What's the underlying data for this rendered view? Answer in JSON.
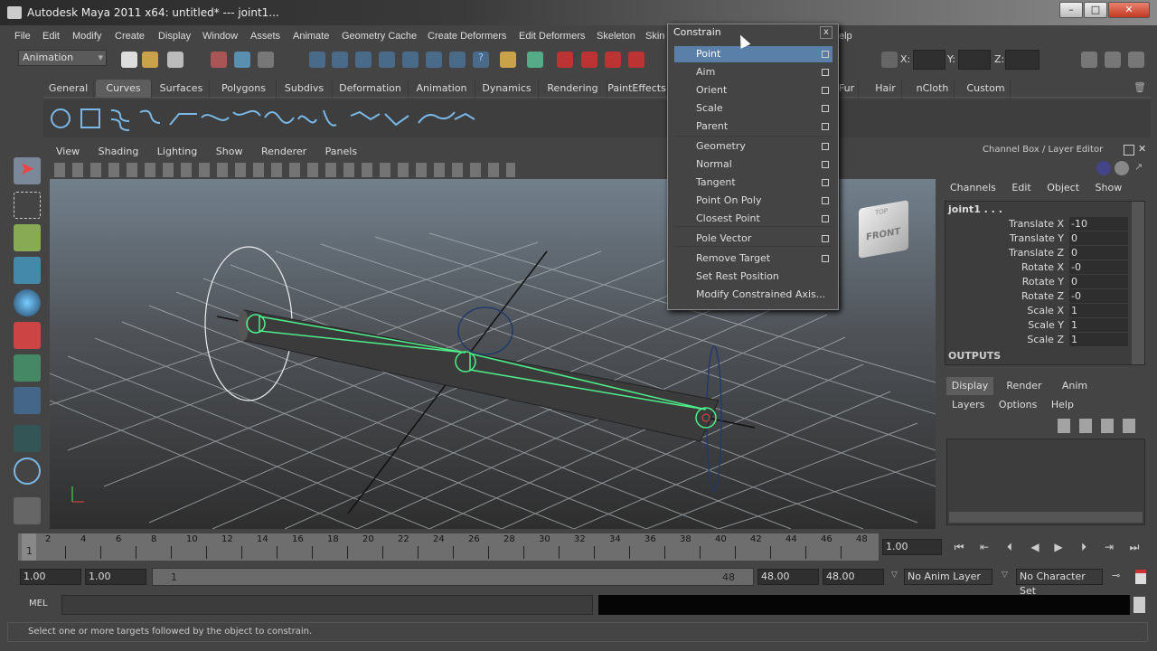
{
  "window": {
    "title": "Autodesk Maya 2011 x64: untitled*   ---   joint1...",
    "min": "–",
    "max": "□",
    "close": "✕"
  },
  "menubar": [
    "File",
    "Edit",
    "Modify",
    "Create",
    "Display",
    "Window",
    "Assets",
    "Animate",
    "Geometry Cache",
    "Create Deformers",
    "Edit Deformers",
    "Skeleton",
    "Skin"
  ],
  "menubar_tail": "elp",
  "toolbar": {
    "menu_set": "Animation",
    "x_label": "X:",
    "y_label": "Y:",
    "z_label": "Z:"
  },
  "shelf_tabs": [
    "General",
    "Curves",
    "Surfaces",
    "Polygons",
    "Subdivs",
    "Deformation",
    "Animation",
    "Dynamics",
    "Rendering",
    "PaintEffects"
  ],
  "shelf_tabs_right": [
    "Fur",
    "Hair",
    "nCloth",
    "Custom"
  ],
  "viewport": {
    "menu": [
      "View",
      "Shading",
      "Lighting",
      "Show",
      "Renderer",
      "Panels"
    ],
    "viewcube_top": "TOP",
    "viewcube_front": "FRONT"
  },
  "channel_box": {
    "title": "Channel Box / Layer Editor",
    "menu": [
      "Channels",
      "Edit",
      "Object",
      "Show"
    ],
    "object": "joint1 . . .",
    "channels": [
      {
        "label": "Translate X",
        "value": "-10"
      },
      {
        "label": "Translate Y",
        "value": "0"
      },
      {
        "label": "Translate Z",
        "value": "0"
      },
      {
        "label": "Rotate X",
        "value": "-0"
      },
      {
        "label": "Rotate Y",
        "value": "0"
      },
      {
        "label": "Rotate Z",
        "value": "-0"
      },
      {
        "label": "Scale X",
        "value": "1"
      },
      {
        "label": "Scale Y",
        "value": "1"
      },
      {
        "label": "Scale Z",
        "value": "1"
      }
    ],
    "outputs": "OUTPUTS"
  },
  "layer_editor": {
    "tabs": [
      "Display",
      "Render",
      "Anim"
    ],
    "menu": [
      "Layers",
      "Options",
      "Help"
    ]
  },
  "constrain_menu": {
    "title": "Constrain",
    "close": "x",
    "items": [
      {
        "label": "Point",
        "option": true,
        "highlighted": true
      },
      {
        "label": "Aim",
        "option": true
      },
      {
        "label": "Orient",
        "option": true
      },
      {
        "label": "Scale",
        "option": true
      },
      {
        "label": "Parent",
        "option": true
      },
      {
        "label": "Geometry",
        "option": true
      },
      {
        "label": "Normal",
        "option": true
      },
      {
        "label": "Tangent",
        "option": true
      },
      {
        "label": "Point On Poly",
        "option": true
      },
      {
        "label": "Closest Point",
        "option": true
      },
      {
        "label": "Pole Vector",
        "option": true
      },
      {
        "label": "Remove Target",
        "option": true
      },
      {
        "label": "Set Rest Position",
        "option": false
      },
      {
        "label": "Modify Constrained Axis...",
        "option": false
      }
    ]
  },
  "timeline": {
    "ticks": [
      "2",
      "4",
      "6",
      "8",
      "10",
      "12",
      "14",
      "16",
      "18",
      "20",
      "22",
      "24",
      "26",
      "28",
      "30",
      "32",
      "34",
      "36",
      "38",
      "40",
      "42",
      "44",
      "46",
      "48"
    ],
    "current": "1",
    "current_time": "1.00"
  },
  "range": {
    "start": "1.00",
    "playback_start": "1.00",
    "slider_start": "1",
    "slider_end": "48",
    "playback_end": "48.00",
    "end": "48.00",
    "anim_layer": "No Anim Layer",
    "character_set": "No Character Set"
  },
  "command": {
    "label": "MEL"
  },
  "help_line": "Select one or more targets followed by the object to constrain."
}
